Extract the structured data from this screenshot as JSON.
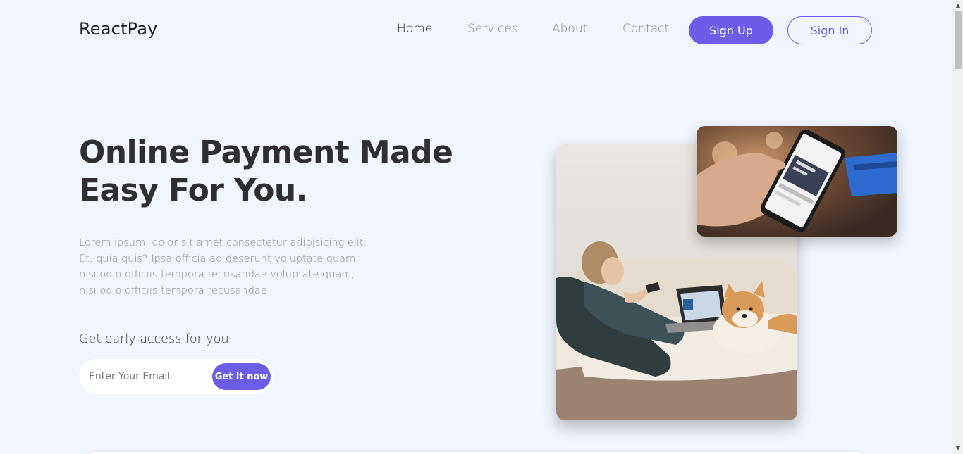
{
  "header": {
    "brand": "ReactPay",
    "nav": [
      {
        "label": "Home",
        "active": true
      },
      {
        "label": "Services",
        "active": false
      },
      {
        "label": "About",
        "active": false
      },
      {
        "label": "Contact",
        "active": false
      }
    ],
    "signup_label": "Sign Up",
    "signin_label": "Sign In"
  },
  "hero": {
    "title_line1": "Online Payment Made",
    "title_line2": "Easy For You.",
    "description": "Lorem ipsum, dolor sit amet consectetur adipisicing elit. Et, quia quis? Ipsa officia ad deserunt voluptate quam, nisi odio officiis tempora recusandae voluptate quam, nisi odio officiis tempora recusandae",
    "early_access": "Get early access for you",
    "email_placeholder": "Enter Your Email",
    "cta_label": "Get it now"
  },
  "colors": {
    "accent": "#6c5ce7",
    "background": "#f0f5fe",
    "heading": "#2f2f2f",
    "muted": "#8a8a8a"
  }
}
